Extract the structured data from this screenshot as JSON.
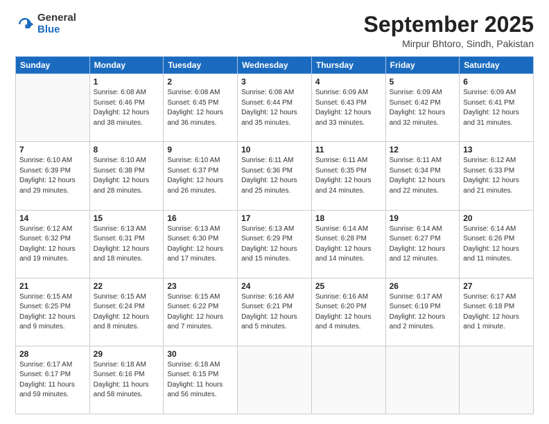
{
  "logo": {
    "general": "General",
    "blue": "Blue"
  },
  "title": "September 2025",
  "subtitle": "Mirpur Bhtoro, Sindh, Pakistan",
  "headers": [
    "Sunday",
    "Monday",
    "Tuesday",
    "Wednesday",
    "Thursday",
    "Friday",
    "Saturday"
  ],
  "weeks": [
    [
      {
        "num": "",
        "info": ""
      },
      {
        "num": "1",
        "info": "Sunrise: 6:08 AM\nSunset: 6:46 PM\nDaylight: 12 hours\nand 38 minutes."
      },
      {
        "num": "2",
        "info": "Sunrise: 6:08 AM\nSunset: 6:45 PM\nDaylight: 12 hours\nand 36 minutes."
      },
      {
        "num": "3",
        "info": "Sunrise: 6:08 AM\nSunset: 6:44 PM\nDaylight: 12 hours\nand 35 minutes."
      },
      {
        "num": "4",
        "info": "Sunrise: 6:09 AM\nSunset: 6:43 PM\nDaylight: 12 hours\nand 33 minutes."
      },
      {
        "num": "5",
        "info": "Sunrise: 6:09 AM\nSunset: 6:42 PM\nDaylight: 12 hours\nand 32 minutes."
      },
      {
        "num": "6",
        "info": "Sunrise: 6:09 AM\nSunset: 6:41 PM\nDaylight: 12 hours\nand 31 minutes."
      }
    ],
    [
      {
        "num": "7",
        "info": "Sunrise: 6:10 AM\nSunset: 6:39 PM\nDaylight: 12 hours\nand 29 minutes."
      },
      {
        "num": "8",
        "info": "Sunrise: 6:10 AM\nSunset: 6:38 PM\nDaylight: 12 hours\nand 28 minutes."
      },
      {
        "num": "9",
        "info": "Sunrise: 6:10 AM\nSunset: 6:37 PM\nDaylight: 12 hours\nand 26 minutes."
      },
      {
        "num": "10",
        "info": "Sunrise: 6:11 AM\nSunset: 6:36 PM\nDaylight: 12 hours\nand 25 minutes."
      },
      {
        "num": "11",
        "info": "Sunrise: 6:11 AM\nSunset: 6:35 PM\nDaylight: 12 hours\nand 24 minutes."
      },
      {
        "num": "12",
        "info": "Sunrise: 6:11 AM\nSunset: 6:34 PM\nDaylight: 12 hours\nand 22 minutes."
      },
      {
        "num": "13",
        "info": "Sunrise: 6:12 AM\nSunset: 6:33 PM\nDaylight: 12 hours\nand 21 minutes."
      }
    ],
    [
      {
        "num": "14",
        "info": "Sunrise: 6:12 AM\nSunset: 6:32 PM\nDaylight: 12 hours\nand 19 minutes."
      },
      {
        "num": "15",
        "info": "Sunrise: 6:13 AM\nSunset: 6:31 PM\nDaylight: 12 hours\nand 18 minutes."
      },
      {
        "num": "16",
        "info": "Sunrise: 6:13 AM\nSunset: 6:30 PM\nDaylight: 12 hours\nand 17 minutes."
      },
      {
        "num": "17",
        "info": "Sunrise: 6:13 AM\nSunset: 6:29 PM\nDaylight: 12 hours\nand 15 minutes."
      },
      {
        "num": "18",
        "info": "Sunrise: 6:14 AM\nSunset: 6:28 PM\nDaylight: 12 hours\nand 14 minutes."
      },
      {
        "num": "19",
        "info": "Sunrise: 6:14 AM\nSunset: 6:27 PM\nDaylight: 12 hours\nand 12 minutes."
      },
      {
        "num": "20",
        "info": "Sunrise: 6:14 AM\nSunset: 6:26 PM\nDaylight: 12 hours\nand 11 minutes."
      }
    ],
    [
      {
        "num": "21",
        "info": "Sunrise: 6:15 AM\nSunset: 6:25 PM\nDaylight: 12 hours\nand 9 minutes."
      },
      {
        "num": "22",
        "info": "Sunrise: 6:15 AM\nSunset: 6:24 PM\nDaylight: 12 hours\nand 8 minutes."
      },
      {
        "num": "23",
        "info": "Sunrise: 6:15 AM\nSunset: 6:22 PM\nDaylight: 12 hours\nand 7 minutes."
      },
      {
        "num": "24",
        "info": "Sunrise: 6:16 AM\nSunset: 6:21 PM\nDaylight: 12 hours\nand 5 minutes."
      },
      {
        "num": "25",
        "info": "Sunrise: 6:16 AM\nSunset: 6:20 PM\nDaylight: 12 hours\nand 4 minutes."
      },
      {
        "num": "26",
        "info": "Sunrise: 6:17 AM\nSunset: 6:19 PM\nDaylight: 12 hours\nand 2 minutes."
      },
      {
        "num": "27",
        "info": "Sunrise: 6:17 AM\nSunset: 6:18 PM\nDaylight: 12 hours\nand 1 minute."
      }
    ],
    [
      {
        "num": "28",
        "info": "Sunrise: 6:17 AM\nSunset: 6:17 PM\nDaylight: 11 hours\nand 59 minutes."
      },
      {
        "num": "29",
        "info": "Sunrise: 6:18 AM\nSunset: 6:16 PM\nDaylight: 11 hours\nand 58 minutes."
      },
      {
        "num": "30",
        "info": "Sunrise: 6:18 AM\nSunset: 6:15 PM\nDaylight: 11 hours\nand 56 minutes."
      },
      {
        "num": "",
        "info": ""
      },
      {
        "num": "",
        "info": ""
      },
      {
        "num": "",
        "info": ""
      },
      {
        "num": "",
        "info": ""
      }
    ]
  ]
}
